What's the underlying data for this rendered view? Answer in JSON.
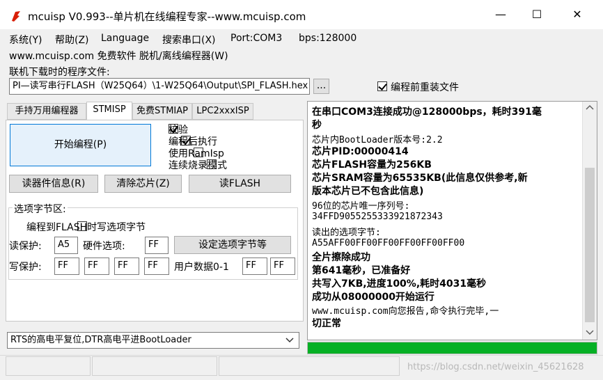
{
  "window": {
    "title": "mcuisp V0.993--单片机在线编程专家--www.mcuisp.com",
    "minimize_label": "—",
    "maximize_label": "☐",
    "close_label": "✕"
  },
  "menu": {
    "items": [
      "系统(Y)",
      "帮助(Z)",
      "Language",
      "搜索串口(X)",
      "Port:COM3",
      "bps:128000"
    ],
    "row2": "www.mcuisp.com 免费软件 脱机/离线编程器(W)"
  },
  "file": {
    "label": "联机下载时的程序文件:",
    "path": "PI—读写串行FLASH（W25Q64）\\1-W25Q64\\Output\\SPI_FLASH.hex",
    "browse_label": "...",
    "reload_label": "编程前重装文件",
    "reload_checked": true
  },
  "tabs": [
    "手持万用编程器",
    "STMISP",
    "免费STMIAP",
    "LPC2xxxISP"
  ],
  "active_tab": 1,
  "program": {
    "start_label": "开始编程(P)",
    "options": [
      {
        "label": "校验",
        "checked": true
      },
      {
        "label": "编程后执行",
        "checked": true
      },
      {
        "label": "使用RamIsp",
        "checked": false
      },
      {
        "label": "连续烧录模式",
        "checked": false
      }
    ],
    "read_info_label": "读器件信息(R)",
    "erase_label": "清除芯片(Z)",
    "read_flash_label": "读FLASH"
  },
  "option_bytes": {
    "group_label": "选项字节区:",
    "write_label": "编程到FLASH时写选项字节",
    "read_protect_label": "读保护:",
    "read_protect_value": "A5",
    "hw_option_label": "硬件选项:",
    "hw_option_value": "FF",
    "set_button_label": "设定选项字节等",
    "write_protect_label": "写保护:",
    "write_protect_values": [
      "FF",
      "FF",
      "FF",
      "FF"
    ],
    "user_data_label": "用户数据0-1",
    "user_data_values": [
      "FF",
      "FF"
    ]
  },
  "bootloader_select": "RTS的高电平复位,DTR高电平进BootLoader",
  "log": [
    "在串口COM3连接成功@128000bps，耗时391毫",
    "秒",
    "芯片内BootLoader版本号:2.2",
    "芯片PID:00000414",
    "芯片FLASH容量为256KB",
    "芯片SRAM容量为65535KB(此信息仅供参考,新",
    "版本芯片已不包含此信息)",
    "96位的芯片唯一序列号:",
    "34FFD9055255333921872343",
    "读出的选项字节:",
    "A55AFF00FF00FF00FF00FF00FF00",
    "全片擦除成功",
    "第641毫秒，已准备好",
    "共写入7KB,进度100%,耗时4031毫秒",
    "成功从08000000开始运行",
    "www.mcuisp.com向您报告,命令执行完毕,一",
    "切正常"
  ],
  "progress_fraction": 1.0,
  "watermark": "https://blog.csdn.net/weixin_45621628",
  "colors": {
    "progress": "#06b025",
    "logo": "#d81e06"
  }
}
